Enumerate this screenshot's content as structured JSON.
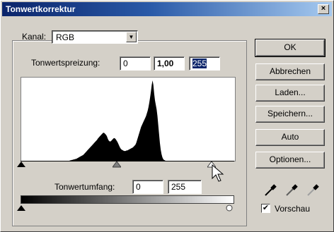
{
  "window": {
    "title": "Tonwertkorrektur"
  },
  "channel": {
    "label": "Kanal:",
    "value": "RGB"
  },
  "input_levels": {
    "label": "Tonwertspreizung:",
    "black": "0",
    "gamma": "1,00",
    "white": "255"
  },
  "output_levels": {
    "label": "Tonwertumfang:",
    "black": "0",
    "white": "255"
  },
  "buttons": {
    "ok": "OK",
    "cancel": "Abbrechen",
    "load": "Laden...",
    "save": "Speichern...",
    "auto": "Auto",
    "options": "Optionen..."
  },
  "preview": {
    "label": "Vorschau",
    "checked": true,
    "check_glyph": "✔"
  },
  "close_glyph": "×",
  "dropdown_glyph": "▼",
  "histogram": {
    "levels": [
      0,
      0,
      0,
      0,
      0,
      0,
      0,
      0,
      0,
      0,
      0,
      0,
      0,
      0,
      0,
      0,
      0,
      0,
      0,
      0,
      0,
      0,
      0,
      0,
      0,
      0,
      0,
      0,
      0,
      0,
      0,
      0,
      0,
      0,
      0,
      0,
      0,
      0,
      0,
      0,
      0,
      0,
      0,
      0,
      0,
      0,
      0,
      0,
      0,
      0,
      0,
      0,
      0,
      0,
      0,
      0,
      0,
      0,
      0,
      0,
      1,
      1,
      2,
      2,
      3,
      3,
      4,
      4,
      5,
      6,
      7,
      8,
      9,
      10,
      11,
      12,
      13,
      15,
      17,
      19,
      21,
      23,
      25,
      27,
      29,
      31,
      33,
      35,
      37,
      39,
      41,
      43,
      45,
      47,
      50,
      52,
      54,
      56,
      58,
      60,
      62,
      63,
      62,
      60,
      58,
      55,
      50,
      46,
      44,
      43,
      44,
      46,
      48,
      50,
      51,
      50,
      48,
      45,
      42,
      38,
      34,
      30,
      27,
      25,
      24,
      23,
      22,
      22,
      22,
      23,
      23,
      24,
      25,
      26,
      27,
      28,
      29,
      30,
      32,
      34,
      36,
      40,
      46,
      52,
      58,
      64,
      70,
      76,
      80,
      84,
      88,
      92,
      96,
      100,
      106,
      112,
      120,
      130,
      142,
      155,
      170,
      180,
      170,
      150,
      135,
      125,
      115,
      100,
      80,
      60,
      40,
      25,
      15,
      8,
      4,
      2,
      1,
      0,
      0,
      0,
      0,
      0,
      0,
      0,
      0,
      0,
      0,
      0,
      0,
      0,
      0,
      0,
      0,
      0,
      0,
      0,
      0,
      0,
      0,
      0,
      0,
      0,
      0,
      0,
      0,
      0,
      0,
      0,
      0,
      0,
      0,
      0,
      0,
      0,
      0,
      0,
      0,
      0,
      0,
      0,
      0,
      0,
      0,
      0,
      0,
      0,
      0,
      0,
      0,
      0,
      0,
      0,
      0,
      0,
      0,
      0,
      0,
      0,
      0,
      0,
      0,
      0,
      0,
      0,
      0,
      0,
      0,
      0,
      0,
      0,
      0,
      0,
      0,
      0,
      0,
      0,
      0,
      0,
      0,
      0,
      0,
      0,
      0
    ]
  }
}
